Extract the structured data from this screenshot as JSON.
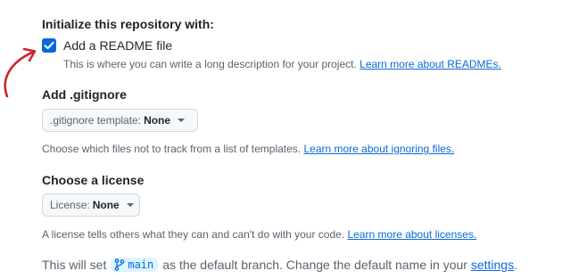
{
  "init": {
    "title": "Initialize this repository with:",
    "readme_checked": true,
    "readme_label": "Add a README file",
    "readme_help_text": "This is where you can write a long description for your project. ",
    "readme_help_link": "Learn more about READMEs."
  },
  "gitignore": {
    "title": "Add .gitignore",
    "select_prefix": ".gitignore template:",
    "select_value": "None",
    "help_text": "Choose which files not to track from a list of templates. ",
    "help_link": "Learn more about ignoring files."
  },
  "license": {
    "title": "Choose a license",
    "select_prefix": "License:",
    "select_value": "None",
    "help_text": "A license tells others what they can and can't do with your code. ",
    "help_link": "Learn more about licenses."
  },
  "footer": {
    "text_before": "This will set",
    "branch": "main",
    "text_after": "as the default branch. Change the default name in your",
    "settings_link": "settings",
    "period": "."
  },
  "colors": {
    "accent": "#0969da",
    "annotation_arrow": "#d1242f"
  },
  "icons": {
    "checkbox": "check-icon",
    "branch": "git-branch-icon",
    "dropdown": "triangle-down-icon",
    "annotation": "curved-arrow-icon"
  }
}
